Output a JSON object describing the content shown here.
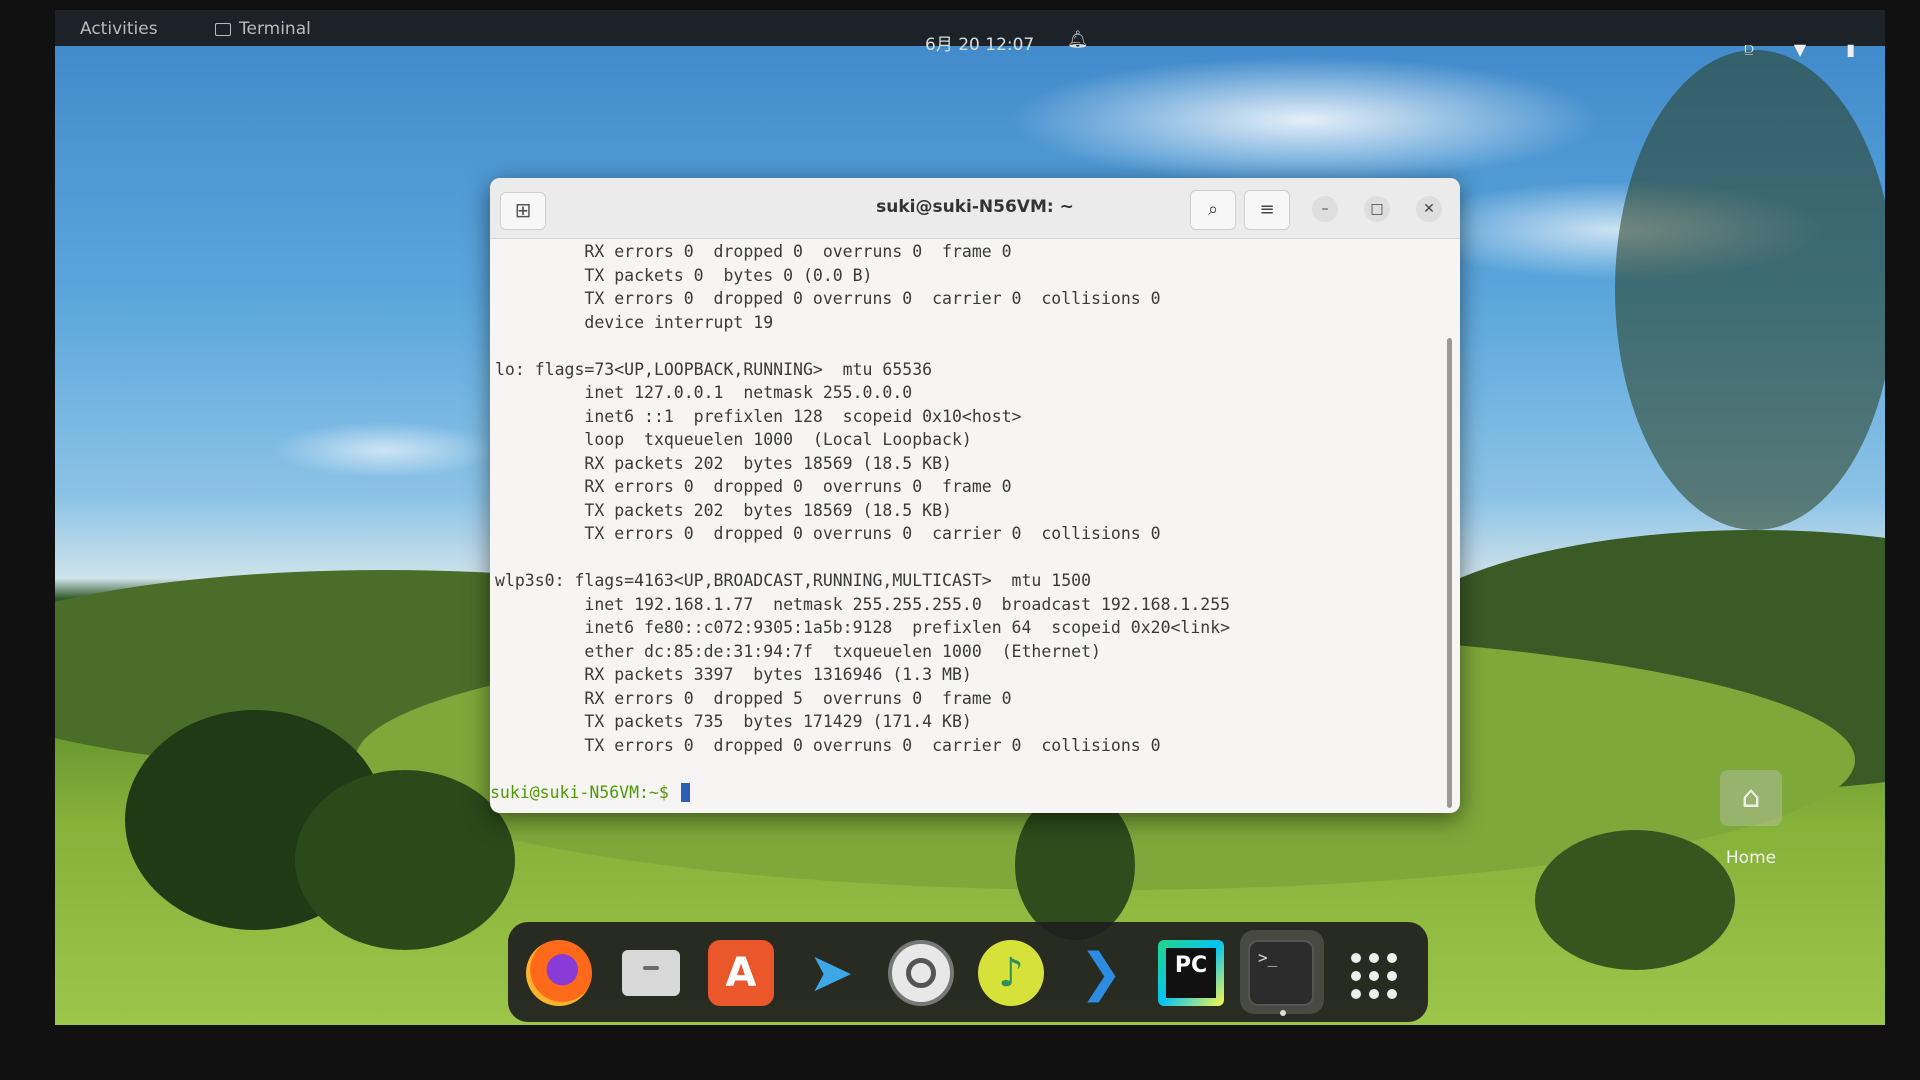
{
  "topbar": {
    "activities": "Activities",
    "app_name": "Terminal",
    "clock": "6月 20  12:07"
  },
  "terminal": {
    "title": "suki@suki-N56VM: ~",
    "lines": [
      "         RX errors 0  dropped 0  overruns 0  frame 0",
      "         TX packets 0  bytes 0 (0.0 B)",
      "         TX errors 0  dropped 0 overruns 0  carrier 0  collisions 0",
      "         device interrupt 19",
      "",
      "lo: flags=73<UP,LOOPBACK,RUNNING>  mtu 65536",
      "         inet 127.0.0.1  netmask 255.0.0.0",
      "         inet6 ::1  prefixlen 128  scopeid 0x10<host>",
      "         loop  txqueuelen 1000  (Local Loopback)",
      "         RX packets 202  bytes 18569 (18.5 KB)",
      "         RX errors 0  dropped 0  overruns 0  frame 0",
      "         TX packets 202  bytes 18569 (18.5 KB)",
      "         TX errors 0  dropped 0 overruns 0  carrier 0  collisions 0",
      "",
      "wlp3s0: flags=4163<UP,BROADCAST,RUNNING,MULTICAST>  mtu 1500",
      "         inet 192.168.1.77  netmask 255.255.255.0  broadcast 192.168.1.255",
      "         inet6 fe80::c072:9305:1a5b:9128  prefixlen 64  scopeid 0x20<link>",
      "         ether dc:85:de:31:94:7f  txqueuelen 1000  (Ethernet)",
      "         RX packets 3397  bytes 1316946 (1.3 MB)",
      "         RX errors 0  dropped 5  overruns 0  frame 0",
      "         TX packets 735  bytes 171429 (171.4 KB)",
      "         TX errors 0  dropped 0 overruns 0  carrier 0  collisions 0",
      ""
    ],
    "prompt": "suki@suki-N56VM:~$ "
  },
  "desktop": {
    "home_label": "Home"
  },
  "icons": {
    "app_menu": "terminal-icon",
    "notification": "bell-icon",
    "new_tab": "new-tab-icon",
    "search": "search-icon",
    "menu": "hamburger-icon",
    "minimize": "minimize-icon",
    "maximize": "maximize-icon",
    "close": "close-icon",
    "home": "home-folder-icon"
  },
  "dock": {
    "apps": [
      "Firefox",
      "Files",
      "Ubuntu Software",
      "Telegram",
      "Settings",
      "Music",
      "Visual Studio Code",
      "PyCharm",
      "Terminal",
      "Show Applications"
    ],
    "pycharm_badge": "PC",
    "software_badge": "A",
    "terminal_badge": ">_"
  },
  "colors": {
    "prompt": "#4e9a06",
    "cursor": "#2e5db3",
    "terminal_bg": "#f6f5f4"
  }
}
